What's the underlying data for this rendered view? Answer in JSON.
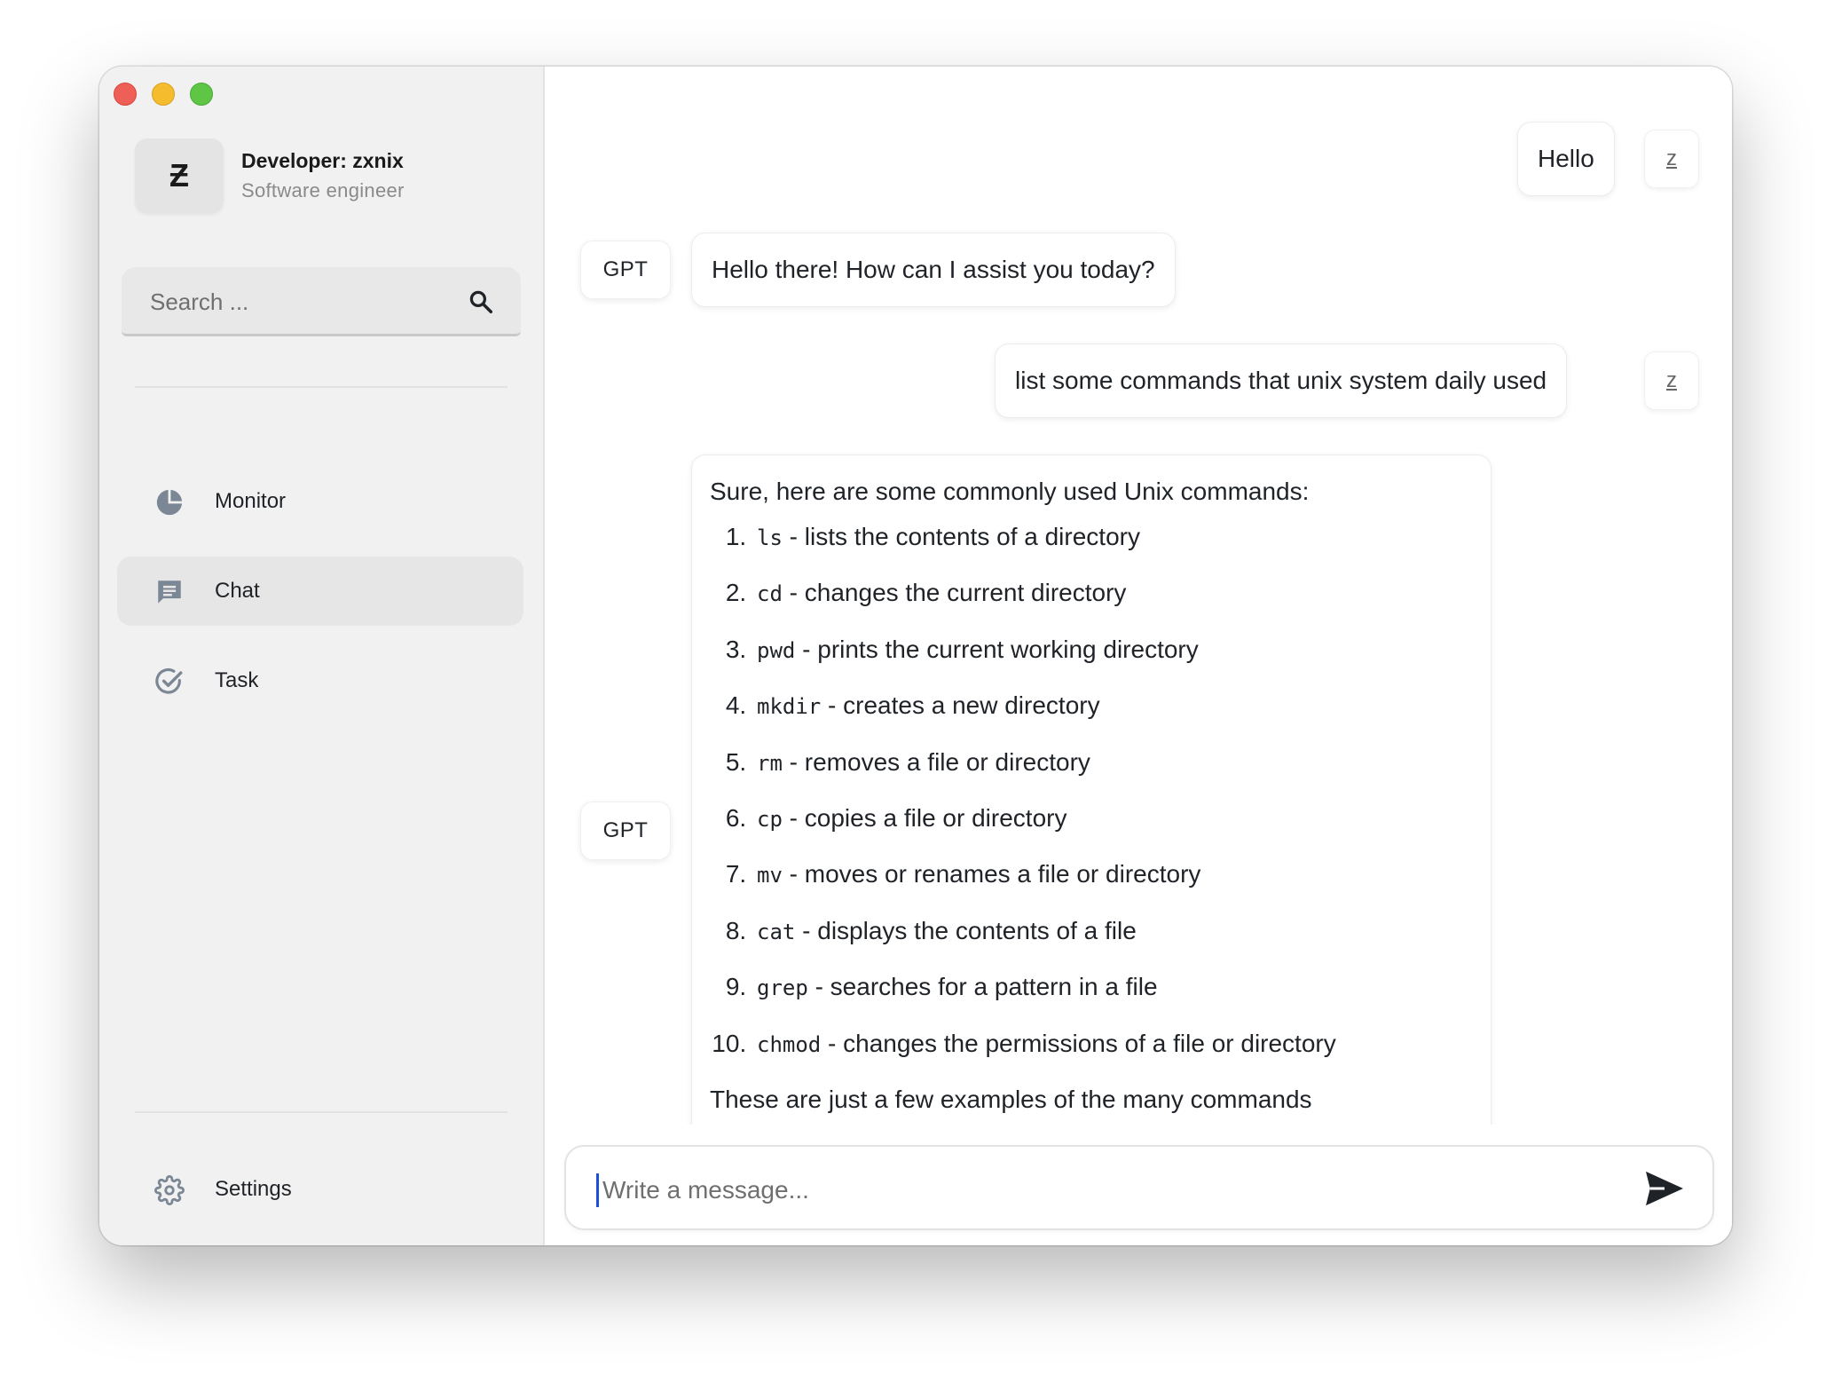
{
  "window": {
    "traffic_lights": [
      "close",
      "minimize",
      "zoom"
    ]
  },
  "profile": {
    "avatar_letter": "Ƶ",
    "name": "Developer: zxnix",
    "role": "Software engineer"
  },
  "search": {
    "placeholder": "Search ...",
    "icon": "search-icon"
  },
  "nav": {
    "items": [
      {
        "label": "Monitor",
        "icon": "pie-chart-icon",
        "active": false
      },
      {
        "label": "Chat",
        "icon": "chat-icon",
        "active": true
      },
      {
        "label": "Task",
        "icon": "check-circle-icon",
        "active": false
      }
    ],
    "settings": {
      "label": "Settings",
      "icon": "gear-icon"
    }
  },
  "chat": {
    "user_avatar": "z",
    "assistant_avatar": "GPT",
    "messages": [
      {
        "role": "user",
        "text": "Hello"
      },
      {
        "role": "assistant",
        "text": "Hello there! How can I assist you today?"
      },
      {
        "role": "user",
        "text": "list some commands that unix system daily used"
      },
      {
        "role": "assistant",
        "intro": "Sure, here are some commonly used Unix commands:",
        "items": [
          {
            "cmd": "ls",
            "desc": " - lists the contents of a directory"
          },
          {
            "cmd": "cd",
            "desc": " - changes the current directory"
          },
          {
            "cmd": "pwd",
            "desc": " - prints the current working directory"
          },
          {
            "cmd": "mkdir",
            "desc": " - creates a new directory"
          },
          {
            "cmd": "rm",
            "desc": " - removes a file or directory"
          },
          {
            "cmd": "cp",
            "desc": " - copies a file or directory"
          },
          {
            "cmd": "mv",
            "desc": " - moves or renames a file or directory"
          },
          {
            "cmd": "cat",
            "desc": " - displays the contents of a file"
          },
          {
            "cmd": "grep",
            "desc": " - searches for a pattern in a file"
          },
          {
            "cmd": "chmod",
            "desc": " - changes the permissions of a file or directory"
          }
        ],
        "outro": "These are just a few examples of the many commands"
      }
    ]
  },
  "composer": {
    "placeholder": "Write a message...",
    "send_icon": "send-icon"
  },
  "colors": {
    "sidebar_bg": "#f1f1f1",
    "active_nav_bg": "#e6e6e6",
    "icon_color": "#7b8794",
    "close": "#ee5f57",
    "minimize": "#f5bd2e",
    "zoom": "#5fc645"
  }
}
